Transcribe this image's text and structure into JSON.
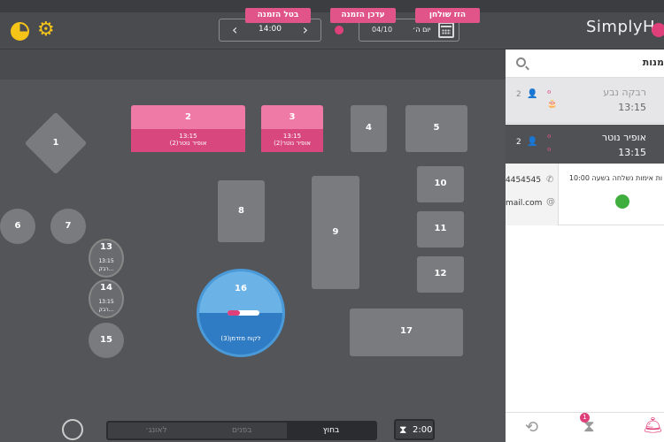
{
  "header": {
    "time": "14:00",
    "date": "04/10",
    "day": "יום ה׳",
    "logo": "SimplyH"
  },
  "toolbar": {
    "move_table": "הזז שולחן",
    "update_reservation": "עדכן הזמנה",
    "cancel_reservation": "בטל הזמנה"
  },
  "tables": {
    "t1": "1",
    "t2": "2",
    "t3": "3",
    "t4": "4",
    "t5": "5",
    "t6": "6",
    "t7": "7",
    "t8": "8",
    "t9": "9",
    "t10": "10",
    "t11": "11",
    "t12": "12",
    "t13": "13",
    "t14": "14",
    "t15": "15",
    "t16": "16",
    "t17": "17"
  },
  "table_details": {
    "t2_time": "13:15",
    "t2_name": "אופיר נוטר(2)",
    "t3_time": "13:15",
    "t3_name": "אופיר נוטר(2)",
    "t13_time": "13:15",
    "t13_name": "רבק...",
    "t14_time": "13:15",
    "t14_name": "רבק...",
    "t16_name": "לקוח מזדמן(3)"
  },
  "sidebar": {
    "title": "מנות",
    "res1": {
      "name": "רבקה נבע",
      "time": "13:15",
      "guests": "2"
    },
    "res2": {
      "name": "אופיר נוטר",
      "time": "13:15",
      "guests": "2"
    },
    "detail": {
      "phone": "4454545",
      "email": "mail.com",
      "note": "ות אימות נשלחה בשעה 10:00"
    },
    "badge_count": "1"
  },
  "bottom": {
    "timer": "2:00",
    "tabs": [
      "לאונג׳",
      "בפנים",
      "בחוץ"
    ]
  },
  "colors": {
    "accent": "#e0548a",
    "yellow": "#f5c419",
    "blue": "#4a9ad9"
  }
}
